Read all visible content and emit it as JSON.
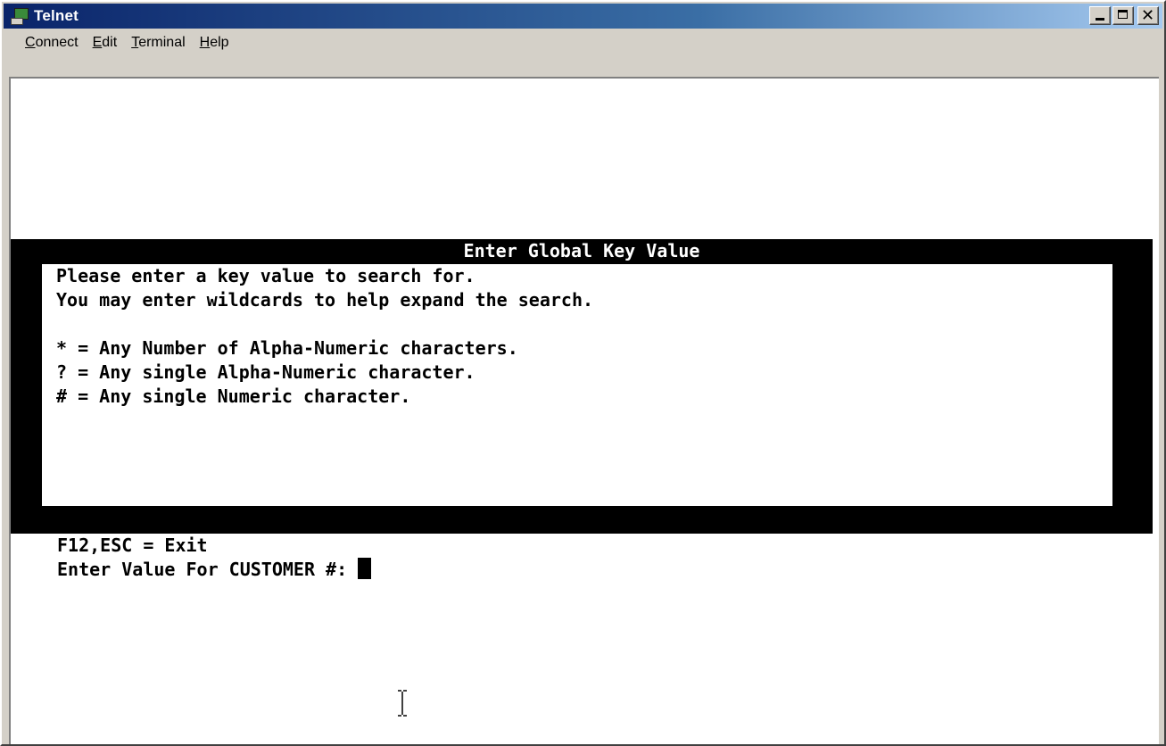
{
  "window": {
    "title": "Telnet"
  },
  "menu": [
    "Connect",
    "Edit",
    "Terminal",
    "Help"
  ],
  "dialog": {
    "title": "Enter Global Key Value",
    "lines": [
      "Please enter a key value to search for.",
      "You may enter wildcards to help expand the search.",
      "",
      "* = Any Number of Alpha-Numeric characters.",
      "? = Any single Alpha-Numeric character.",
      "# = Any single Numeric character."
    ]
  },
  "footer": {
    "exit_hint": "F12,ESC = Exit",
    "prompt": "Enter Value For CUSTOMER #: ",
    "input_value": ""
  },
  "icons": {
    "app": "telnet-app-icon",
    "minimize": "minimize-icon",
    "maximize": "maximize-icon",
    "close": "close-icon",
    "cursor": "text-cursor-icon"
  }
}
